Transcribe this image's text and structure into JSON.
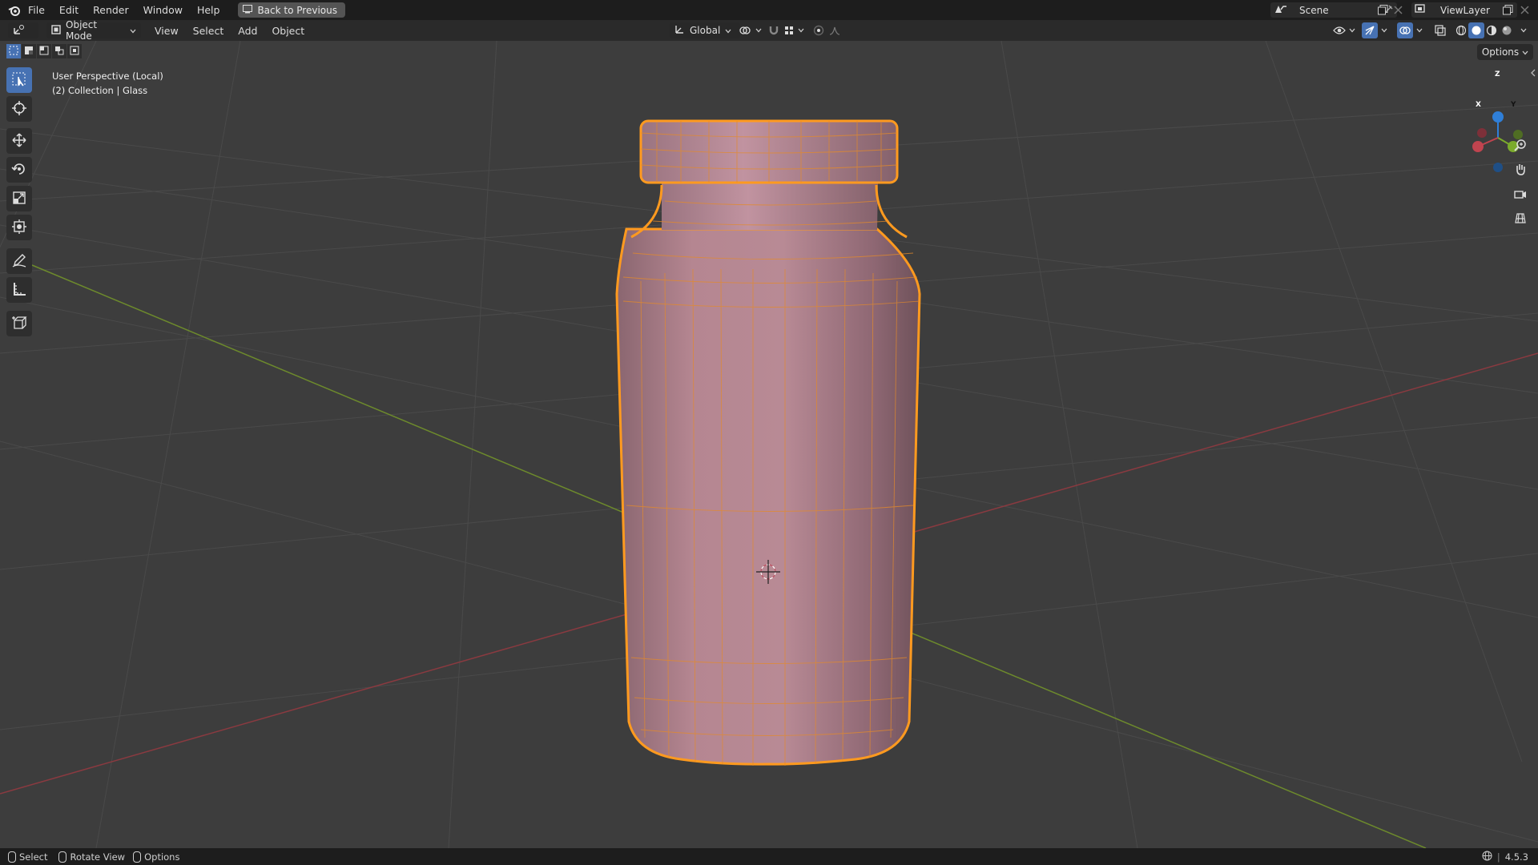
{
  "topbar": {
    "menu": [
      "File",
      "Edit",
      "Render",
      "Window",
      "Help"
    ],
    "back_button": "Back to Previous",
    "scene": "Scene",
    "view_layer": "ViewLayer"
  },
  "header": {
    "mode": "Object Mode",
    "menus": [
      "View",
      "Select",
      "Add",
      "Object"
    ],
    "orientation": "Global"
  },
  "viewport": {
    "perspective_label": "User Perspective (Local)",
    "collection_label": "(2) Collection | Glass",
    "options_label": "Options",
    "gizmo": {
      "x": "X",
      "y": "Y",
      "z": "Z"
    }
  },
  "toolbar": {
    "tools": [
      "select-box",
      "cursor",
      "move",
      "rotate",
      "scale",
      "transform",
      "annotate",
      "measure",
      "add-cube"
    ]
  },
  "statusbar": {
    "select": "Select",
    "rotate": "Rotate View",
    "options": "Options",
    "version": "4.5.3"
  },
  "colors": {
    "selection_outline": "#ff9a1f",
    "mesh": "#b8838f",
    "x_axis": "#c0444f",
    "y_axis": "#7bab2c",
    "z_axis": "#2f7fd8",
    "active_tool": "#4772b3"
  }
}
